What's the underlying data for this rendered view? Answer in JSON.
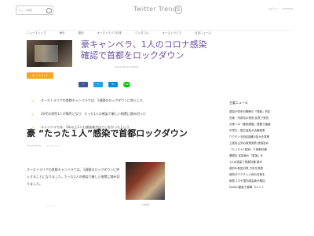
{
  "header": {
    "search_placeholder": "ニュース検索",
    "logo_text": "Twitter Trends",
    "login_label": "ログイン",
    "register_label": "Fieldbase"
  },
  "nav": {
    "items": [
      "ニューストップ",
      "海外",
      "国内",
      "オーストラリア日本",
      "ワンダフル",
      "オーストラリア",
      "日本ニュース"
    ]
  },
  "hero": {
    "title": "豪キャンベラ、1人のコロナ感染確認で首都をロックダウン",
    "meta": "2021年8月12日 17時05分"
  },
  "category": {
    "badge": "オーストラリア"
  },
  "shares": {
    "facebook": "f",
    "twitter": "t",
    "hatena": "B!",
    "line": "LINE"
  },
  "points": [
    "オーストラリアの首都キャンベラでは、1週間のロックダウンに突入した",
    "20代の男性1人が陽性となり、たった1人の感染で厳しい措置に踏み切った",
    "キャンベラでは、1年以上1人も感染者が出ていなかったという"
  ],
  "article": {
    "heading": "豪 “たった１人”感染で首都ロックダウン",
    "date": "2021年8月12日",
    "source": "オーストラリア",
    "body": "オーストラリアの首都キャンベラでは、1週間のロックダウンに突入することになりました。たった1人の感染で厳しい措置に踏み切りました。",
    "image_caption": "写真提供",
    "dots": "○○○"
  },
  "sidebar": {
    "title": "主要ニュース",
    "items": [
      "感染が初来日閣僚の「検査」判定",
      "石破・内政治の官邸 会見で発言",
      "大阪への「雇用調整」措置で議論",
      "中学生・国立高校が合格発表",
      "ワクチン3回目接種の拡大を表明",
      "立憲民主党の政策発表 首相答弁",
      "「たった1人感染」で首都封鎖",
      "選挙区 民放局の「表演」を",
      "1人の感染で首都封鎖 豪州",
      "政府の新型対策 方針を発表",
      "政府がワクチン入荷の日程を",
      "新型コロナ国内感染者が増加",
      "DaiGo 動画で謝罪 コメント"
    ]
  }
}
